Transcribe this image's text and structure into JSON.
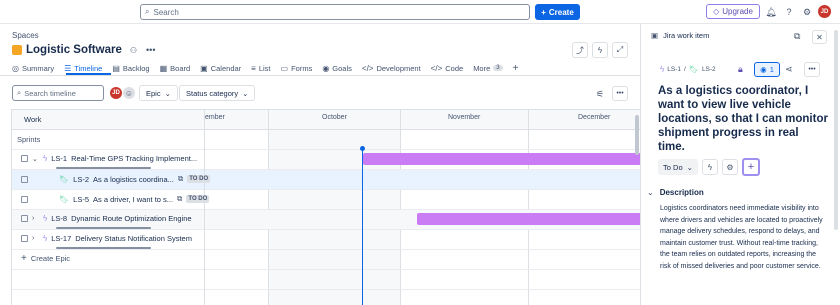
{
  "topbar": {
    "search_placeholder": "Search",
    "create_label": "Create",
    "upgrade_label": "Upgrade",
    "avatar_initials": "JD"
  },
  "project": {
    "spaces_label": "Spaces",
    "name": "Logistic Software"
  },
  "tabs": [
    "Summary",
    "Timeline",
    "Backlog",
    "Board",
    "Calendar",
    "List",
    "Forms",
    "Goals",
    "Development",
    "Code",
    "More"
  ],
  "more_count": "3",
  "toolbar": {
    "search_placeholder": "Search timeline",
    "avatar_initials": "JD",
    "epic_label": "Epic",
    "status_label": "Status category"
  },
  "timeline": {
    "work_header": "Work",
    "months": [
      "ember",
      "October",
      "November",
      "December"
    ],
    "sprints_label": "Sprints",
    "rows": [
      {
        "key": "LS-1",
        "title": "Real-Time GPS Tracking Implement..."
      },
      {
        "key": "LS-2",
        "title": "As a logistics coordina...",
        "status": "TO DO"
      },
      {
        "key": "LS-5",
        "title": "As a driver, I want to s...",
        "status": "TO DO"
      },
      {
        "key": "LS-8",
        "title": "Dynamic Route Optimization Engine"
      },
      {
        "key": "LS-17",
        "title": "Delivery Status Notification System"
      }
    ],
    "create_epic": "Create Epic"
  },
  "panel": {
    "header": "Jira work item",
    "crumb_parent": "LS-1",
    "crumb_child": "LS-2",
    "watch_count": "1",
    "title": "As a logistics coordinator, I want to view live vehicle locations, so that I can monitor shipment progress in real time.",
    "status_button": "To Do",
    "description_heading": "Description",
    "description": "Logistics coordinators need immediate visibility into where drivers and vehicles are located to proactively manage delivery schedules, respond to delays, and maintain customer trust. Without real-time tracking, the team relies on outdated reports, increasing the risk of missed deliveries and poor customer service."
  },
  "colors": {
    "accent": "#0c66e4",
    "epic_bar": "#c97cf4",
    "today_line": "#0c66e4"
  }
}
